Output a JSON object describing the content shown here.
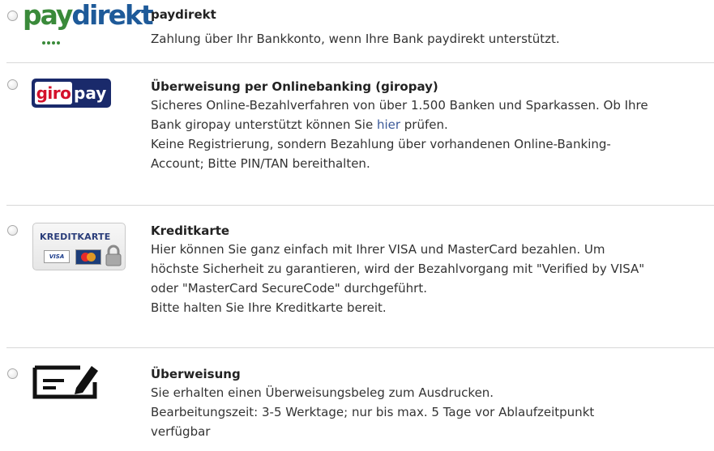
{
  "options": [
    {
      "id": "paydirekt",
      "logo_text": "paydirekt",
      "title": "paydirekt",
      "lines": [
        "Zahlung über Ihr Bankkonto, wenn Ihre Bank paydirekt unterstützt."
      ]
    },
    {
      "id": "giropay",
      "logo_giro": "giro",
      "logo_pay": "pay",
      "title": "Überweisung per Onlinebanking (giropay)",
      "line1": "Sicheres Online-Bezahlverfahren von über 1.500 Banken und Sparkassen. Ob Ihre",
      "line2_before": "Bank giropay unterstützt können Sie ",
      "line2_link": "hier",
      "line2_after": " prüfen.",
      "line3": "Keine Registrierung, sondern Bezahlung über vorhandenen Online-Banking-",
      "line4": "Account; Bitte PIN/TAN bereithalten."
    },
    {
      "id": "kreditkarte",
      "logo_text": "KREDITKARTE",
      "logo_visa": "VISA",
      "title": "Kreditkarte",
      "lines": [
        "Hier können Sie ganz einfach mit Ihrer VISA und MasterCard bezahlen. Um",
        "höchste Sicherheit zu garantieren, wird der Bezahlvorgang mit \"Verified by VISA\"",
        "oder \"MasterCard SecureCode\" durchgeführt.",
        "Bitte halten Sie Ihre Kreditkarte bereit."
      ]
    },
    {
      "id": "ueberweisung",
      "title": "Überweisung",
      "lines": [
        "Sie erhalten einen Überweisungsbeleg zum Ausdrucken.",
        "Bearbeitungszeit: 3-5 Werktage; nur bis max. 5 Tage vor Ablaufzeitpunkt",
        "verfügbar"
      ]
    }
  ],
  "colors": {
    "paydirekt_green": "#3a8a3a",
    "paydirekt_blue": "#1e5a99",
    "giropay_navy": "#1a2a6b",
    "giropay_red": "#d4102b",
    "link": "#3b5998",
    "separator": "#d8d8d8"
  }
}
